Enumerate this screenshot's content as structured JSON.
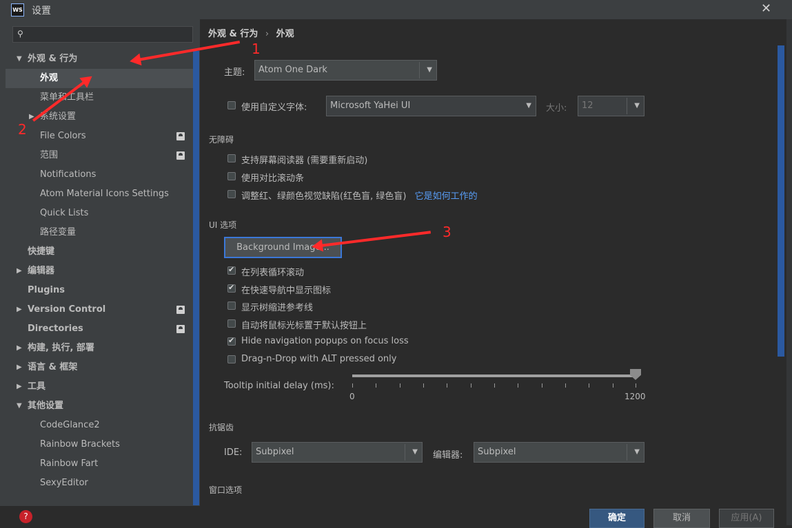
{
  "window": {
    "title": "设置",
    "app_icon_text": "WS"
  },
  "search": {
    "placeholder": ""
  },
  "sidebar": {
    "items": [
      {
        "label": "外观 & 行为",
        "arrow": "▼"
      },
      {
        "label": "外观"
      },
      {
        "label": "菜单和工具栏"
      },
      {
        "label": "系统设置",
        "arrow": "▶"
      },
      {
        "label": "File Colors"
      },
      {
        "label": "范围"
      },
      {
        "label": "Notifications"
      },
      {
        "label": "Atom Material Icons Settings"
      },
      {
        "label": "Quick Lists"
      },
      {
        "label": "路径变量"
      },
      {
        "label": "快捷键"
      },
      {
        "label": "编辑器",
        "arrow": "▶"
      },
      {
        "label": "Plugins"
      },
      {
        "label": "Version Control",
        "arrow": "▶"
      },
      {
        "label": "Directories"
      },
      {
        "label": "构建, 执行, 部署",
        "arrow": "▶"
      },
      {
        "label": "语言 & 框架",
        "arrow": "▶"
      },
      {
        "label": "工具",
        "arrow": "▶"
      },
      {
        "label": "其他设置",
        "arrow": "▼"
      },
      {
        "label": "CodeGlance2"
      },
      {
        "label": "Rainbow Brackets"
      },
      {
        "label": "Rainbow Fart"
      },
      {
        "label": "SexyEditor"
      }
    ]
  },
  "breadcrumb": {
    "parent": "外观 & 行为",
    "separator": "›",
    "current": "外观"
  },
  "theme": {
    "label": "主题:",
    "value": "Atom One Dark"
  },
  "custom_font": {
    "label": "使用自定义字体:",
    "value": "Microsoft YaHei UI",
    "size_label": "大小:",
    "size_value": "12",
    "checked": false
  },
  "accessibility": {
    "title": "无障碍",
    "options": [
      {
        "label": "支持屏幕阅读器 (需要重新启动)",
        "checked": false
      },
      {
        "label": "使用对比滚动条",
        "checked": false
      },
      {
        "label": "调整红、绿颜色视觉缺陷(红色盲, 绿色盲)",
        "checked": false
      }
    ],
    "link": "它是如何工作的"
  },
  "ui_options": {
    "title": "UI 选项",
    "background_button": "Background Image...",
    "options": [
      {
        "label": "在列表循环滚动",
        "checked": true
      },
      {
        "label": "在快速导航中显示图标",
        "checked": true
      },
      {
        "label": "显示树缩进参考线",
        "checked": false
      },
      {
        "label": "自动将鼠标光标置于默认按钮上",
        "checked": false
      },
      {
        "label": "Hide navigation popups on focus loss",
        "checked": true
      },
      {
        "label": "Drag-n-Drop with ALT pressed only",
        "checked": false
      }
    ]
  },
  "tooltip_delay": {
    "label": "Tooltip initial delay (ms):",
    "min": "0",
    "max": "1200",
    "value": 1200
  },
  "antialiasing": {
    "title": "抗锯齿",
    "ide_label": "IDE:",
    "ide_value": "Subpixel",
    "editor_label": "编辑器:",
    "editor_value": "Subpixel"
  },
  "window_options": {
    "title": "窗口选项"
  },
  "footer": {
    "ok": "确定",
    "cancel": "取消",
    "apply": "应用(A)",
    "help": "?"
  },
  "annotations": {
    "n1": "1",
    "n2": "2",
    "n3": "3"
  },
  "colors": {
    "accent": "#3b78d8",
    "scrollbar": "#2b59a0",
    "annotation": "#ff2a2a",
    "link": "#589df6"
  }
}
